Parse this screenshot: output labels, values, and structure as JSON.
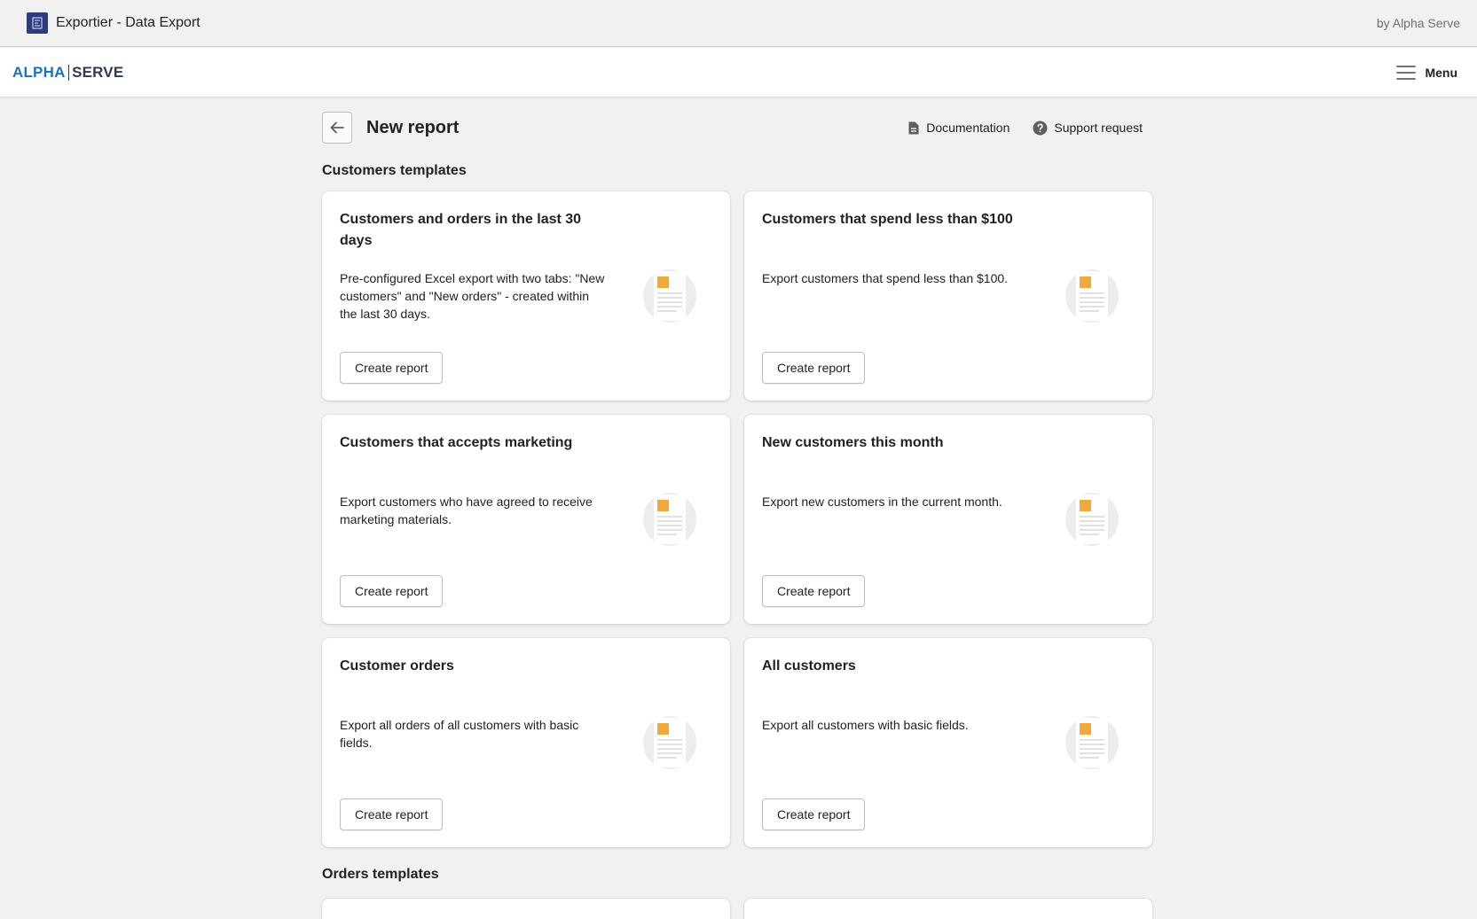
{
  "app": {
    "title": "Exportier - Data Export",
    "by": "by Alpha Serve",
    "icon": "exportier-app-icon"
  },
  "nav": {
    "brand_a": "ALPHA",
    "brand_b": "SERVE",
    "menu_label": "Menu"
  },
  "page": {
    "title": "New report",
    "links": [
      {
        "label": "Documentation",
        "icon": "document-icon"
      },
      {
        "label": "Support request",
        "icon": "question-circle-icon"
      }
    ]
  },
  "sections": {
    "customers_title": "Customers templates",
    "orders_title": "Orders templates"
  },
  "cards": [
    {
      "title": "Customers and orders in the last 30 days",
      "description": "Pre-configured Excel export with two tabs: \"New customers\" and \"New orders\" - created within the last 30 days.",
      "button": "Create report"
    },
    {
      "title": "Customers that spend less than $100",
      "description": "Export customers that spend less than $100.",
      "button": "Create report"
    },
    {
      "title": "Customers that accepts marketing",
      "description": "Export customers who have agreed to receive marketing materials.",
      "button": "Create report"
    },
    {
      "title": "New customers this month",
      "description": "Export new customers in the current month.",
      "button": "Create report"
    },
    {
      "title": "Customer orders",
      "description": "Export all orders of all customers with basic fields.",
      "button": "Create report"
    },
    {
      "title": "All customers",
      "description": "Export all customers with basic fields.",
      "button": "Create report"
    }
  ],
  "colors": {
    "accent_blue": "#1a73c8",
    "brand_dark": "#2f3b52",
    "illustration_orange": "#f2a93b"
  }
}
